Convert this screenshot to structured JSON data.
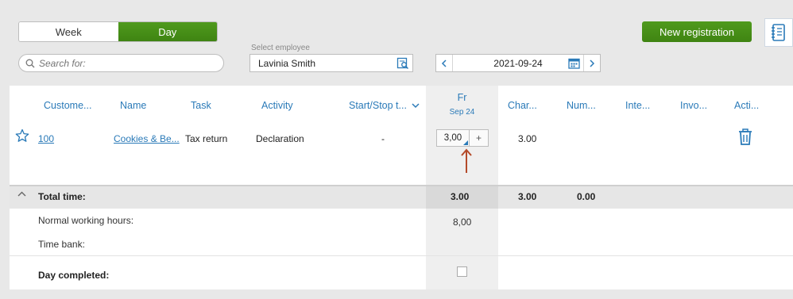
{
  "view_toggle": {
    "week": "Week",
    "day": "Day"
  },
  "toolbar": {
    "new_registration": "New registration"
  },
  "search": {
    "placeholder": "Search for:"
  },
  "employee": {
    "label": "Select employee",
    "value": "Lavinia Smith"
  },
  "date": {
    "value": "2021-09-24"
  },
  "columns": {
    "customer": "Custome...",
    "name": "Name",
    "task": "Task",
    "activity": "Activity",
    "startstop": "Start/Stop t...",
    "day": "Fr",
    "day_date": "Sep 24",
    "charge": "Char...",
    "num": "Num...",
    "inte": "Inte...",
    "invo": "Invo...",
    "actions": "Acti..."
  },
  "row": {
    "customer": "100",
    "name": "Cookies & Be...",
    "task": "Tax return",
    "activity": "Declaration",
    "startstop": "-",
    "hours": "3,00",
    "stepper_plus": "+",
    "charge": "3.00"
  },
  "totals": {
    "label": "Total time:",
    "day": "3.00",
    "charge": "3.00",
    "num": "0.00"
  },
  "normal_hours": {
    "label": "Normal working hours:",
    "value": "8,00"
  },
  "time_bank": {
    "label": "Time bank:"
  },
  "day_completed": {
    "label": "Day completed:"
  },
  "colors": {
    "green": "#4a9418",
    "link": "#2a7ab8",
    "arrow": "#b44a2a"
  }
}
